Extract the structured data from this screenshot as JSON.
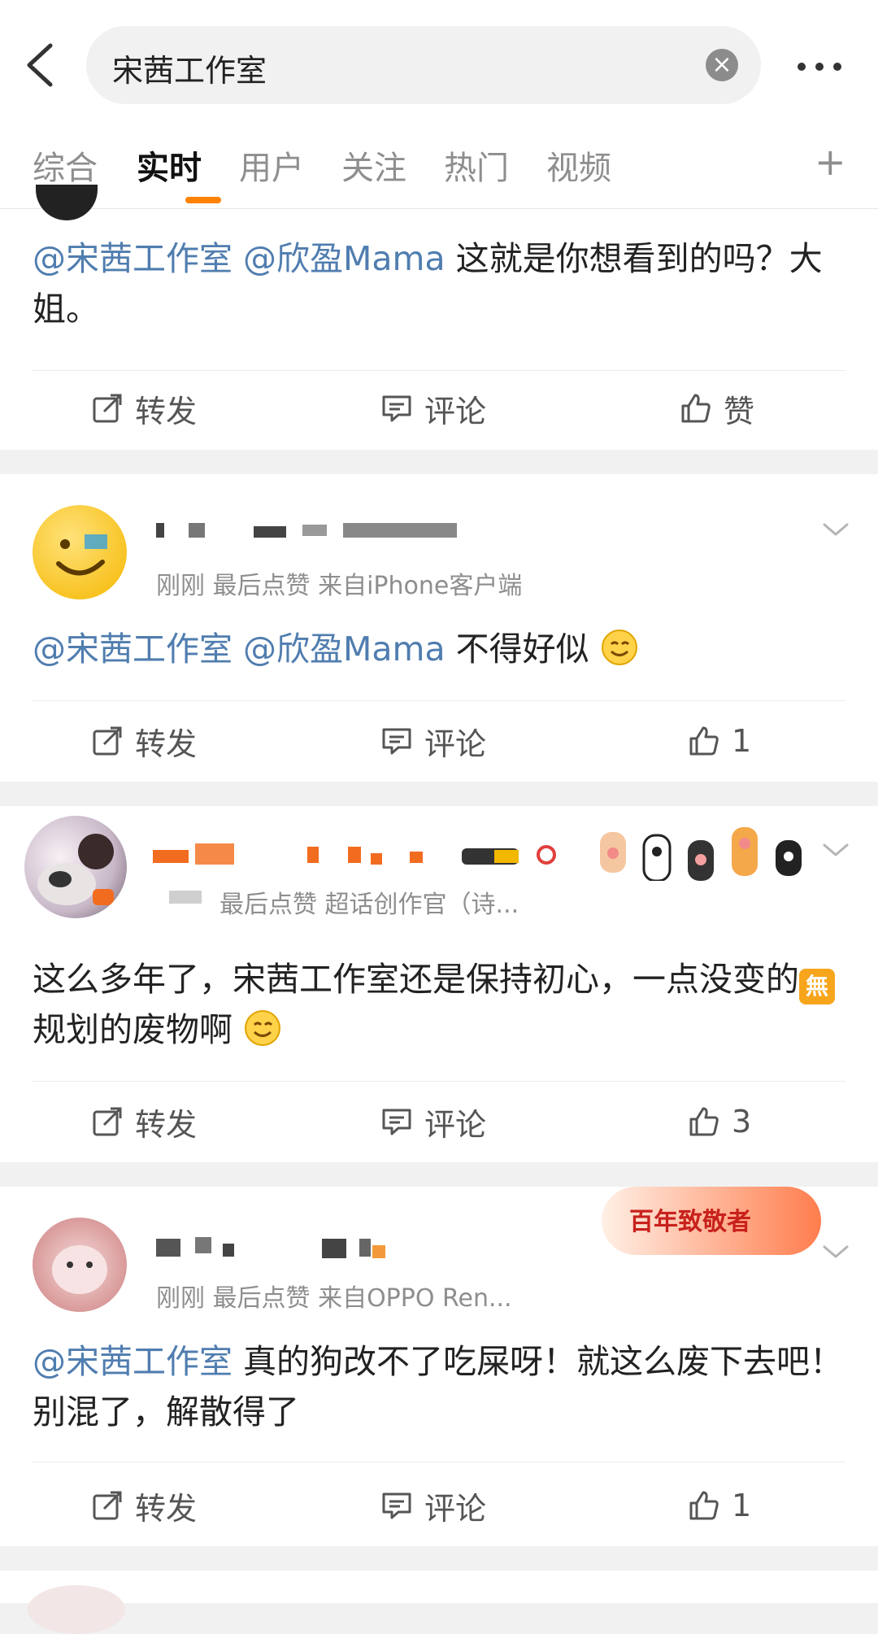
{
  "search": {
    "query": "宋茜工作室",
    "clear_icon": "close-icon"
  },
  "tabs": [
    {
      "label": "综合",
      "active": false
    },
    {
      "label": "实时",
      "active": true
    },
    {
      "label": "用户",
      "active": false
    },
    {
      "label": "关注",
      "active": false
    },
    {
      "label": "热门",
      "active": false
    },
    {
      "label": "视频",
      "active": false
    }
  ],
  "tab_plus": "+",
  "actions_labels": {
    "repost": "转发",
    "comment": "评论",
    "like": "赞"
  },
  "posts": [
    {
      "mentions": [
        "@宋茜工作室",
        "@欣盈Mama"
      ],
      "text": "这就是你想看到的吗？大姐。",
      "likes": "赞"
    },
    {
      "meta": "刚刚 最后点赞 来自iPhone客户端",
      "mentions": [
        "@宋茜工作室",
        "@欣盈Mama"
      ],
      "text": "不得好似",
      "likes": "1"
    },
    {
      "meta": "最后点赞 超话创作官（诗...",
      "text_a": "这么多年了，宋茜工作室还是保持初心，一点没变的",
      "badge": "無",
      "text_b": "规划的废物啊",
      "likes": "3"
    },
    {
      "meta": "刚刚 最后点赞 来自OPPO Ren...",
      "award": "百年致敬者",
      "mentions": [
        "@宋茜工作室"
      ],
      "text": "真的狗改不了吃屎呀！就这么废下去吧！别混了，解散得了",
      "likes": "1"
    }
  ],
  "colors": {
    "accent": "#ff8200",
    "mention": "#507daf",
    "muted": "#8e8e8e"
  }
}
